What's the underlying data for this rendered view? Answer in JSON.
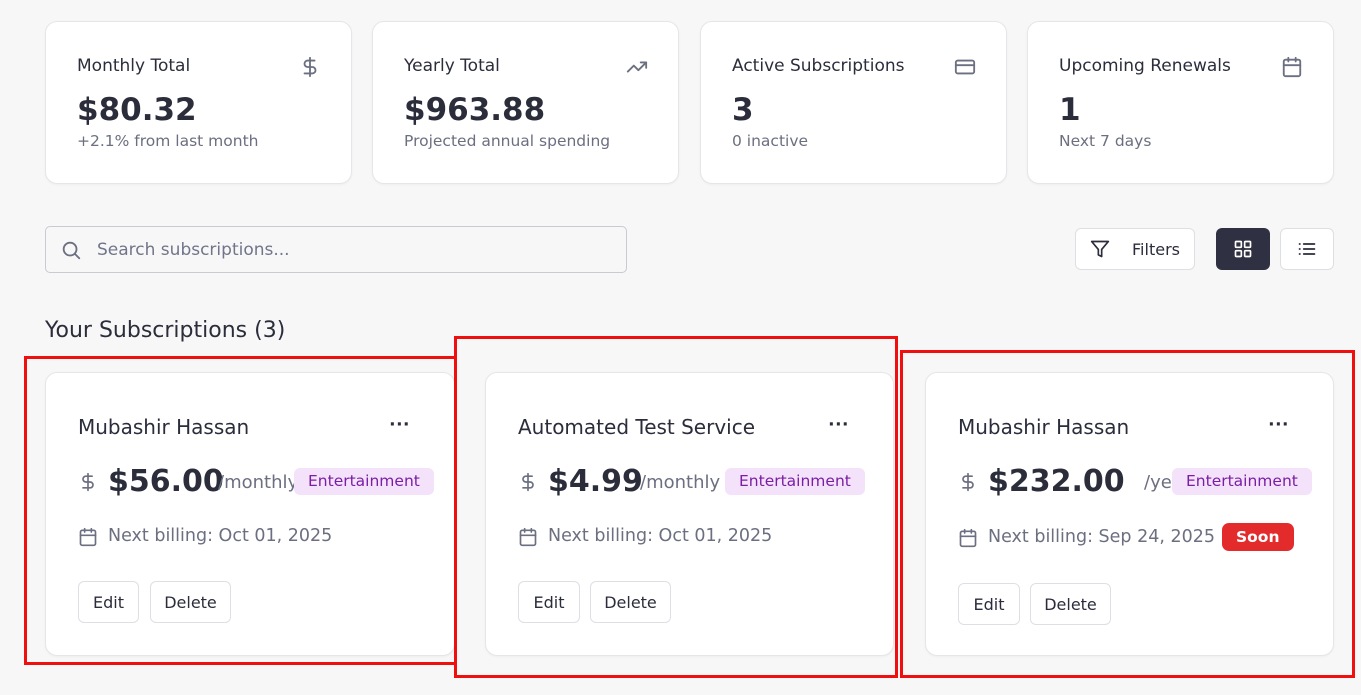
{
  "stats": [
    {
      "label": "Monthly Total",
      "value": "$80.32",
      "sub": "+2.1% from last month",
      "icon": "dollar-icon"
    },
    {
      "label": "Yearly Total",
      "value": "$963.88",
      "sub": "Projected annual spending",
      "icon": "trending-up-icon"
    },
    {
      "label": "Active Subscriptions",
      "value": "3",
      "sub": "0 inactive",
      "icon": "credit-card-icon"
    },
    {
      "label": "Upcoming Renewals",
      "value": "1",
      "sub": "Next 7 days",
      "icon": "calendar-icon"
    }
  ],
  "toolbar": {
    "search_placeholder": "Search subscriptions...",
    "filters_label": "Filters",
    "view_mode": "grid"
  },
  "section": {
    "title": "Your Subscriptions (3)"
  },
  "subscriptions": [
    {
      "name": "Mubashir Hassan",
      "price": "$56.00",
      "period": "/monthly",
      "category": "Entertainment",
      "next_billing": "Next billing: Oct 01, 2025",
      "badge": "",
      "edit": "Edit",
      "delete": "Delete",
      "more": "···"
    },
    {
      "name": "Automated Test Service",
      "price": "$4.99",
      "period": "/monthly",
      "category": "Entertainment",
      "next_billing": "Next billing: Oct 01, 2025",
      "badge": "",
      "edit": "Edit",
      "delete": "Delete",
      "more": "···"
    },
    {
      "name": "Mubashir Hassan",
      "price": "$232.00",
      "period": "/yearly",
      "category": "Entertainment",
      "next_billing": "Next billing: Sep 24, 2025",
      "badge": "Soon",
      "edit": "Edit",
      "delete": "Delete",
      "more": "···"
    }
  ],
  "colors": {
    "accent_dark": "#2f3142",
    "tag_bg": "#f4e2fb",
    "tag_text": "#7a1fa5",
    "soon_bg": "#e32b2b",
    "highlight": "#f00f0f"
  }
}
